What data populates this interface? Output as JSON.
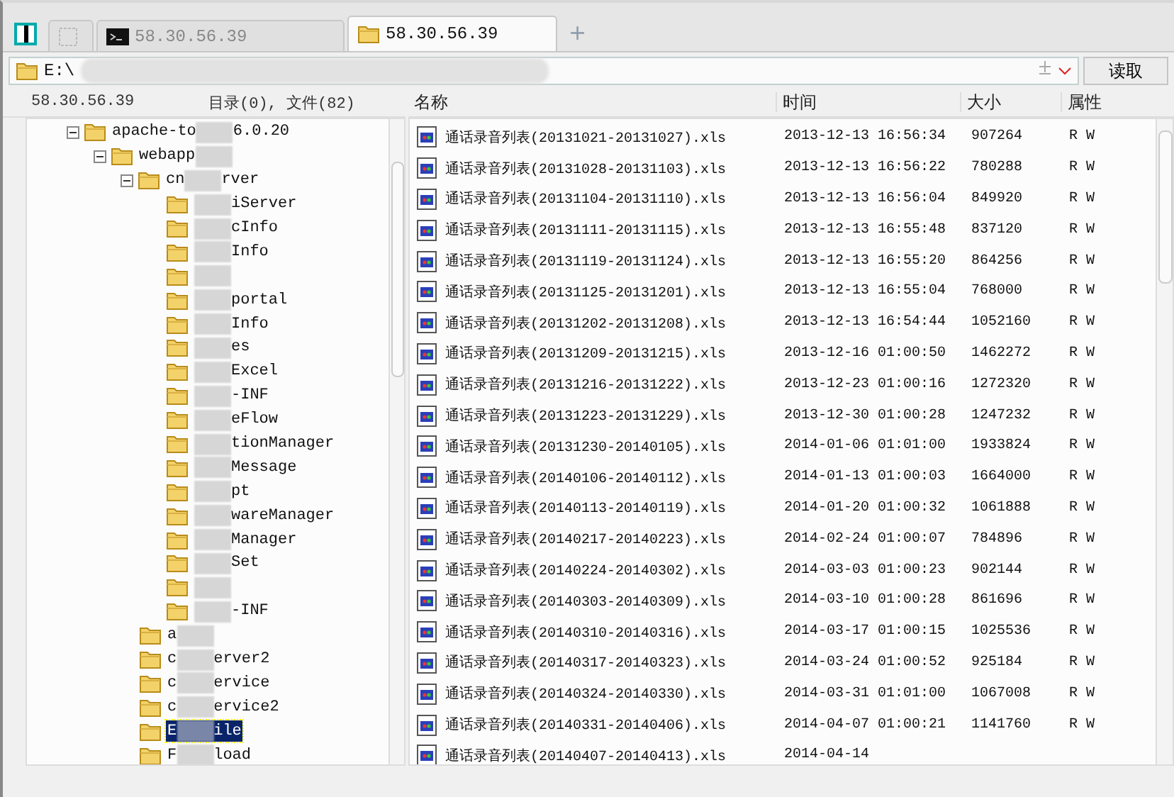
{
  "tabs": [
    {
      "kind": "blank",
      "selected": false
    },
    {
      "kind": "terminal",
      "label": "58.30.56.39",
      "selected": false
    },
    {
      "kind": "folder",
      "label": "58.30.56.39",
      "selected": true
    }
  ],
  "new_tab": "+",
  "address": {
    "value": "E:\\",
    "redacted": true,
    "button": "读取"
  },
  "tree_header": {
    "host": "58.30.56.39",
    "summary": "目录(0), 文件(82)"
  },
  "tree": [
    {
      "label_start": "apache-to",
      "label_end": "6.0.20",
      "redacted": true,
      "expanded": true,
      "selected": false,
      "children": [
        {
          "label_start": "webapp",
          "redacted": true,
          "expanded": true,
          "selected": false,
          "children": [
            {
              "label_start": "cn",
              "label_end": "rver",
              "redacted": true,
              "expanded": true,
              "selected": false,
              "children": [
                {
                  "label_end": "iServer",
                  "redacted": true,
                  "selected": false
                },
                {
                  "label_end": "cInfo",
                  "redacted": true,
                  "selected": false
                },
                {
                  "label_end": "Info",
                  "redacted": true,
                  "selected": false
                },
                {
                  "redacted": true,
                  "selected": false
                },
                {
                  "label_end": "portal",
                  "redacted": true,
                  "selected": false
                },
                {
                  "label_end": "Info",
                  "redacted": true,
                  "selected": false
                },
                {
                  "label_end": "es",
                  "redacted": true,
                  "selected": false
                },
                {
                  "label_end": "Excel",
                  "redacted": true,
                  "selected": false
                },
                {
                  "label_end": "-INF",
                  "redacted": true,
                  "selected": false
                },
                {
                  "label_end": "eFlow",
                  "redacted": true,
                  "selected": false
                },
                {
                  "label_end": "tionManager",
                  "redacted": true,
                  "selected": false
                },
                {
                  "label_end": "Message",
                  "redacted": true,
                  "selected": false
                },
                {
                  "label_end": "pt",
                  "redacted": true,
                  "selected": false
                },
                {
                  "label_end": "wareManager",
                  "redacted": true,
                  "selected": false
                },
                {
                  "label_end": "Manager",
                  "redacted": true,
                  "selected": false
                },
                {
                  "label_end": "Set",
                  "redacted": true,
                  "selected": false
                },
                {
                  "redacted": true,
                  "selected": false
                },
                {
                  "label_end": "-INF",
                  "redacted": true,
                  "selected": false
                }
              ]
            },
            {
              "label_start": "a",
              "redacted": true,
              "selected": false
            },
            {
              "label_start": "c",
              "label_end": "erver2",
              "redacted": true,
              "selected": false
            },
            {
              "label_start": "c",
              "label_end": "ervice",
              "redacted": true,
              "selected": false
            },
            {
              "label_start": "c",
              "label_end": "ervice2",
              "redacted": true,
              "selected": false
            },
            {
              "label_start": "E",
              "label_end": "ile",
              "redacted": true,
              "selected": true
            },
            {
              "label_start": "F",
              "label_end": "load",
              "redacted": true,
              "selected": false
            }
          ]
        }
      ]
    }
  ],
  "table": {
    "columns": [
      "名称",
      "时间",
      "大小",
      "属性"
    ],
    "rows": [
      {
        "name": "通话录音列表(20131021-20131027).xls",
        "time": "2013-12-13 16:56:34",
        "size": "907264",
        "attr": "R W"
      },
      {
        "name": "通话录音列表(20131028-20131103).xls",
        "time": "2013-12-13 16:56:22",
        "size": "780288",
        "attr": "R W"
      },
      {
        "name": "通话录音列表(20131104-20131110).xls",
        "time": "2013-12-13 16:56:04",
        "size": "849920",
        "attr": "R W"
      },
      {
        "name": "通话录音列表(20131111-20131115).xls",
        "time": "2013-12-13 16:55:48",
        "size": "837120",
        "attr": "R W"
      },
      {
        "name": "通话录音列表(20131119-20131124).xls",
        "time": "2013-12-13 16:55:20",
        "size": "864256",
        "attr": "R W"
      },
      {
        "name": "通话录音列表(20131125-20131201).xls",
        "time": "2013-12-13 16:55:04",
        "size": "768000",
        "attr": "R W"
      },
      {
        "name": "通话录音列表(20131202-20131208).xls",
        "time": "2013-12-13 16:54:44",
        "size": "1052160",
        "attr": "R W"
      },
      {
        "name": "通话录音列表(20131209-20131215).xls",
        "time": "2013-12-16 01:00:50",
        "size": "1462272",
        "attr": "R W"
      },
      {
        "name": "通话录音列表(20131216-20131222).xls",
        "time": "2013-12-23 01:00:16",
        "size": "1272320",
        "attr": "R W"
      },
      {
        "name": "通话录音列表(20131223-20131229).xls",
        "time": "2013-12-30 01:00:28",
        "size": "1247232",
        "attr": "R W"
      },
      {
        "name": "通话录音列表(20131230-20140105).xls",
        "time": "2014-01-06 01:01:00",
        "size": "1933824",
        "attr": "R W"
      },
      {
        "name": "通话录音列表(20140106-20140112).xls",
        "time": "2014-01-13 01:00:03",
        "size": "1664000",
        "attr": "R W"
      },
      {
        "name": "通话录音列表(20140113-20140119).xls",
        "time": "2014-01-20 01:00:32",
        "size": "1061888",
        "attr": "R W"
      },
      {
        "name": "通话录音列表(20140217-20140223).xls",
        "time": "2014-02-24 01:00:07",
        "size": "784896",
        "attr": "R W"
      },
      {
        "name": "通话录音列表(20140224-20140302).xls",
        "time": "2014-03-03 01:00:23",
        "size": "902144",
        "attr": "R W"
      },
      {
        "name": "通话录音列表(20140303-20140309).xls",
        "time": "2014-03-10 01:00:28",
        "size": "861696",
        "attr": "R W"
      },
      {
        "name": "通话录音列表(20140310-20140316).xls",
        "time": "2014-03-17 01:00:15",
        "size": "1025536",
        "attr": "R W"
      },
      {
        "name": "通话录音列表(20140317-20140323).xls",
        "time": "2014-03-24 01:00:52",
        "size": "925184",
        "attr": "R W"
      },
      {
        "name": "通话录音列表(20140324-20140330).xls",
        "time": "2014-03-31 01:01:00",
        "size": "1067008",
        "attr": "R W"
      },
      {
        "name": "通话录音列表(20140331-20140406).xls",
        "time": "2014-04-07 01:00:21",
        "size": "1141760",
        "attr": "R W"
      },
      {
        "name": "通话录音列表(20140407-20140413).xls",
        "time": "2014-04-14"
      }
    ]
  }
}
